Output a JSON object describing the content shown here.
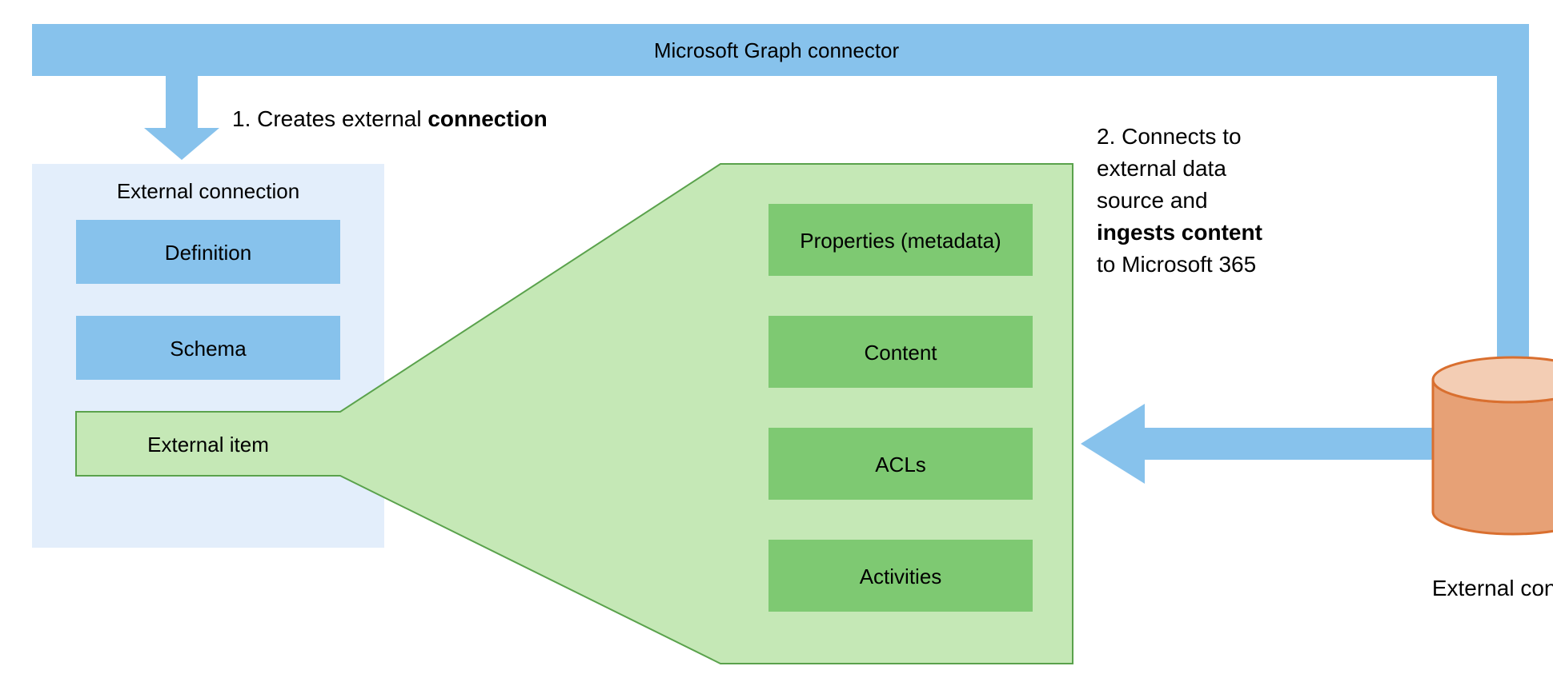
{
  "header": {
    "title": "Microsoft Graph connector"
  },
  "step1": {
    "prefix": "1. Creates external ",
    "bold": "connection"
  },
  "step2": {
    "line1": "2. Connects to",
    "line2": "external data",
    "line3": "source and",
    "line4_bold": "ingests content",
    "line5": "to Microsoft 365"
  },
  "left_panel": {
    "title": "External connection",
    "definition": "Definition",
    "schema": "Schema",
    "external_item": "External item"
  },
  "right_panel": {
    "properties": "Properties (metadata)",
    "content": "Content",
    "acls": "ACLs",
    "activities": "Activities"
  },
  "datastore": {
    "label": "External content"
  },
  "colors": {
    "blue_fill": "#87c2ec",
    "blue_panel": "#e3eefb",
    "green_light": "#c5e8b6",
    "green_dark": "#7ec972",
    "green_stroke": "#5aa24c",
    "db_fill": "#e7a176",
    "db_top": "#f3cdb4",
    "db_stroke": "#d96f2f",
    "text": "#1b1b1b"
  }
}
